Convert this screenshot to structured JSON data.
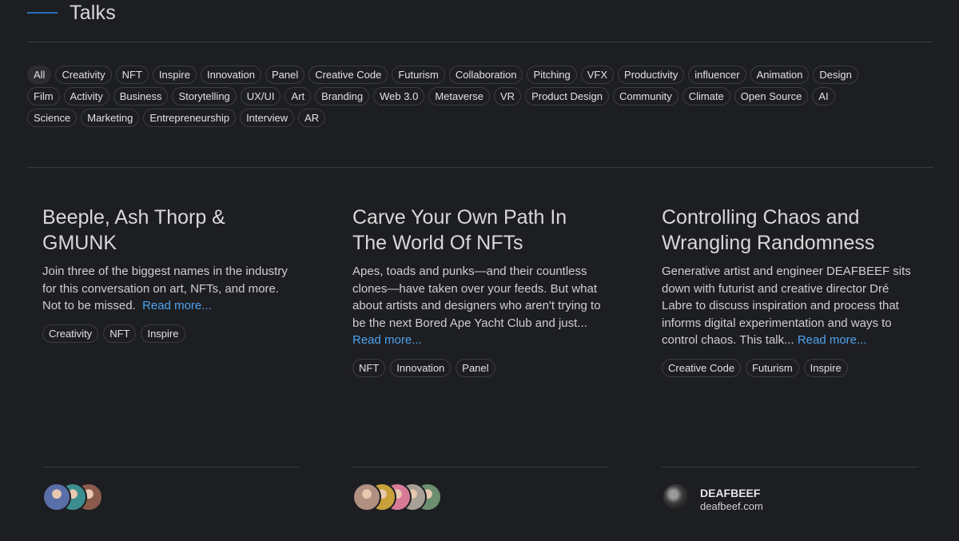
{
  "header": {
    "title": "Talks"
  },
  "tag_rows": [
    [
      "All",
      "Creativity",
      "NFT",
      "Inspire",
      "Innovation",
      "Panel",
      "Creative Code",
      "Futurism",
      "Collaboration",
      "Pitching",
      "VFX",
      "Productivity",
      "influencer",
      "Animation",
      "Design"
    ],
    [
      "Film",
      "Activity",
      "Business",
      "Storytelling",
      "UX/UI",
      "Art",
      "Branding",
      "Web 3.0",
      "Metaverse",
      "VR",
      "Product Design",
      "Community",
      "Climate",
      "Open Source",
      "AI"
    ],
    [
      "Science",
      "Marketing",
      "Entrepreneurship",
      "Interview",
      "AR"
    ]
  ],
  "cards": [
    {
      "title_line1": "Beeple, Ash Thorp &",
      "title_line2": "GMUNK",
      "description": "Join three of the biggest names in the industry for this conversation on art, NFTs, and more. Not to be missed.",
      "read_more": "Read more...",
      "tags": [
        "Creativity",
        "NFT",
        "Inspire"
      ]
    },
    {
      "title_line1": "Carve Your Own Path In",
      "title_line2": "The World Of NFTs",
      "description": "Apes, toads and punks—and their countless clones—have taken over your feeds. But what about artists and designers who aren't trying to be the next Bored Ape Yacht Club and just...",
      "read_more": "Read more...",
      "tags": [
        "NFT",
        "Innovation",
        "Panel"
      ]
    },
    {
      "title_line1": "Controlling Chaos and",
      "title_line2": "Wrangling Randomness",
      "description": "Generative artist and engineer DEAFBEEF sits down with futurist and creative director Dré Labre to discuss inspiration and process that informs digital experimentation and ways to control chaos. This talk...",
      "read_more": "Read more...",
      "tags": [
        "Creative Code",
        "Futurism",
        "Inspire"
      ],
      "author": {
        "name": "DEAFBEEF",
        "site": "deafbeef.com"
      }
    }
  ],
  "avatar_colors": {
    "card1": [
      "#5a6fa8",
      "#3c8d8f",
      "#8a5a4a"
    ],
    "card2": [
      "#b09080",
      "#c9a03a",
      "#d77a98",
      "#a8a095",
      "#6c8f70"
    ]
  }
}
